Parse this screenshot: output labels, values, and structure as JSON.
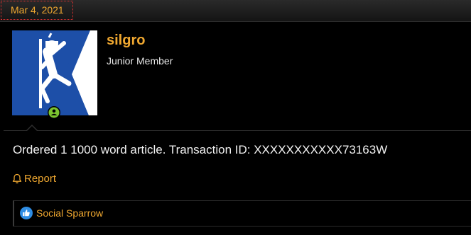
{
  "post": {
    "date": "Mar 4, 2021",
    "message": "Ordered 1 1000 word article. Transaction ID: XXXXXXXXXXX73163W",
    "report_label": "Report"
  },
  "user": {
    "name": "silgro",
    "title": "Junior Member",
    "avatar_icon": "climber-avatar-icon",
    "status": "online"
  },
  "reactions": {
    "icon": "like-icon",
    "users": "Social Sparrow"
  },
  "colors": {
    "accent": "#f0a830",
    "avatar_blue": "#1d4fa8",
    "online_green": "#7cc430",
    "like_blue": "#2f8de4",
    "background": "#000000"
  }
}
